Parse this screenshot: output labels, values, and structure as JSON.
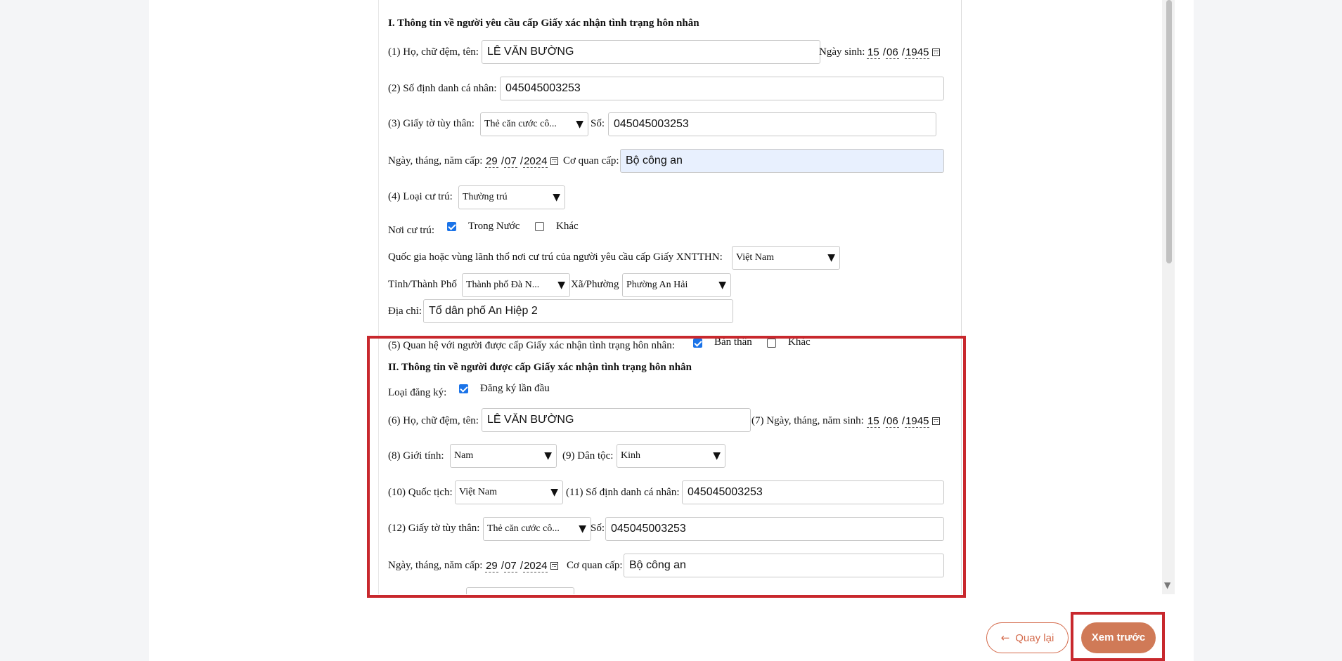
{
  "section1": {
    "title": "I. Thông tin về người yêu cầu cấp Giấy xác nhận tình trạng hôn nhân",
    "name_label": "(1) Họ, chữ đệm, tên:",
    "name_value": "LÊ VĂN BƯỜNG",
    "dob_label": "Ngày sinh:",
    "dob": {
      "d": "15",
      "m": "06",
      "y": "1945"
    },
    "id_label": "(2) Số định danh cá nhân:",
    "id_value": "045045003253",
    "doc_label": "(3) Giấy tờ tùy thân:",
    "doc_type": "Thẻ căn cước cô...",
    "doc_no_label": "Số:",
    "doc_no_value": "045045003253",
    "issue_date_label": "Ngày, tháng, năm cấp:",
    "issue_date": {
      "d": "29",
      "m": "07",
      "y": "2024"
    },
    "issuer_label": "Cơ quan cấp:",
    "issuer_value": "Bộ công an",
    "residence_type_label": "(4) Loại cư trú:",
    "residence_type": "Thường trú",
    "residence_place_label": "Nơi cư trú:",
    "residence_domestic": "Trong Nước",
    "residence_other": "Khác",
    "country_label": "Quốc gia hoặc vùng lãnh thổ nơi cư trú của người yêu cầu cấp Giấy XNTTHN:",
    "country_value": "Việt Nam",
    "province_label": "Tỉnh/Thành Phố",
    "province_value": "Thành phố Đà N...",
    "ward_label": "Xã/Phường",
    "ward_value": "Phường An Hải",
    "address_label": "Địa chỉ:",
    "address_value": "Tổ dân phố An Hiệp 2",
    "relation_label": "(5) Quan hệ với người được cấp Giấy xác nhận tình trạng hôn nhân:",
    "relation_self": "Bản thân",
    "relation_other": "Khác"
  },
  "section2": {
    "title": "II. Thông tin về người được cấp Giấy xác nhận tình trạng hôn nhân",
    "reg_type_label": "Loại đăng ký:",
    "reg_type_value": "Đăng ký lần đầu",
    "name_label": "(6) Họ, chữ đệm, tên:",
    "name_value": "LÊ VĂN BƯỜNG",
    "dob_label": "(7) Ngày, tháng, năm sinh:",
    "dob": {
      "d": "15",
      "m": "06",
      "y": "1945"
    },
    "gender_label": "(8) Giới tính:",
    "gender_value": "Nam",
    "ethnic_label": "(9) Dân tộc:",
    "ethnic_value": "Kinh",
    "nationality_label": "(10) Quốc tịch:",
    "nationality_value": "Việt Nam",
    "id_label": "(11) Số định danh cá nhân:",
    "id_value": "045045003253",
    "doc_label": "(12) Giấy tờ tùy thân:",
    "doc_type": "Thẻ căn cước cô...",
    "doc_no_label": "Số:",
    "doc_no_value": "045045003253",
    "issue_date_label": "Ngày, tháng, năm cấp:",
    "issue_date": {
      "d": "29",
      "m": "07",
      "y": "2024"
    },
    "issuer_label": "Cơ quan cấp:",
    "issuer_value": "Bộ công an"
  },
  "footer": {
    "back_arrow": "←",
    "back_label": "Quay lại",
    "preview_label": "Xem trước"
  },
  "icons": {
    "dropdown": "▼",
    "scroll_down": "▼"
  },
  "colors": {
    "highlight_border": "#c8282d",
    "primary_button": "#d07a57",
    "checkbox": "#1a73e8"
  }
}
